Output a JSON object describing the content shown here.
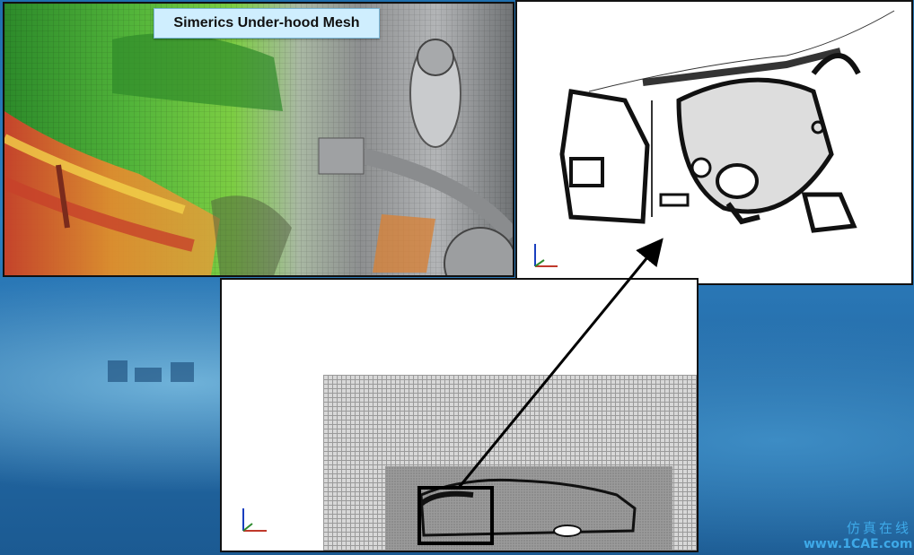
{
  "title_label": "Simerics Under-hood Mesh",
  "watermark": {
    "line1": "仿真在线",
    "line2": "www.1CAE.com"
  },
  "axis_triad": {
    "z": "z",
    "x": "x"
  },
  "colors": {
    "label_bg": "#cfeefe",
    "mesh_green": "#52b43a",
    "mesh_red": "#d53c2b",
    "mesh_orange": "#e98a2e",
    "arrow": "#000000",
    "background_blue": "#246aa6"
  }
}
